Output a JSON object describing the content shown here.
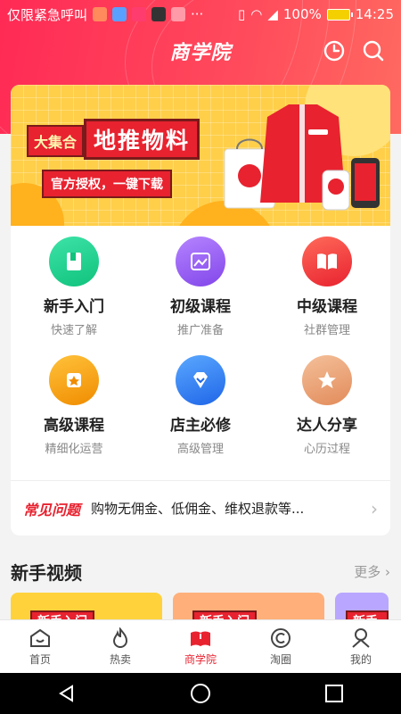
{
  "status_bar": {
    "carrier_text": "仅限紧急呼叫",
    "battery_percent": "100%",
    "time": "14:25"
  },
  "header": {
    "title": "商学院",
    "history_icon": "clock-icon",
    "search_icon": "search-icon"
  },
  "banner": {
    "tag": "大集合",
    "headline": "地推物料",
    "subtitle": "官方授权，一键下载"
  },
  "menu": [
    {
      "title": "新手入门",
      "subtitle": "快速了解",
      "icon": "book-icon",
      "color": "#1fcf8f"
    },
    {
      "title": "初级课程",
      "subtitle": "推广准备",
      "icon": "image-icon",
      "color": "#9b5cf0"
    },
    {
      "title": "中级课程",
      "subtitle": "社群管理",
      "icon": "open-book-icon",
      "color": "#f23a3a"
    },
    {
      "title": "高级课程",
      "subtitle": "精细化运营",
      "icon": "star-badge-icon",
      "color": "#f4a30f"
    },
    {
      "title": "店主必修",
      "subtitle": "高级管理",
      "icon": "diamond-icon",
      "color": "#2f7df2"
    },
    {
      "title": "达人分享",
      "subtitle": "心历过程",
      "icon": "star-icon",
      "color": "#e8a877"
    }
  ],
  "faq": {
    "tag": "常见问题",
    "text": "购物无佣金、低佣金、维权退款等..."
  },
  "section": {
    "title": "新手视频",
    "more": "更多"
  },
  "videos": [
    {
      "label": "新手入门",
      "color": "#ffd23c"
    },
    {
      "label": "新手入门",
      "color": "#ffb07a"
    },
    {
      "label": "新手入",
      "color": "#b9a6ff"
    }
  ],
  "tabs": [
    {
      "label": "首页",
      "icon": "home-icon",
      "active": false
    },
    {
      "label": "热卖",
      "icon": "flame-icon",
      "active": false
    },
    {
      "label": "商学院",
      "icon": "academy-icon",
      "active": true
    },
    {
      "label": "淘圈",
      "icon": "circle-c-icon",
      "active": false
    },
    {
      "label": "我的",
      "icon": "profile-icon",
      "active": false
    }
  ],
  "colors": {
    "accent": "#e8222f",
    "header_gradient_start": "#ff2a55",
    "header_gradient_end": "#ff6a60"
  }
}
